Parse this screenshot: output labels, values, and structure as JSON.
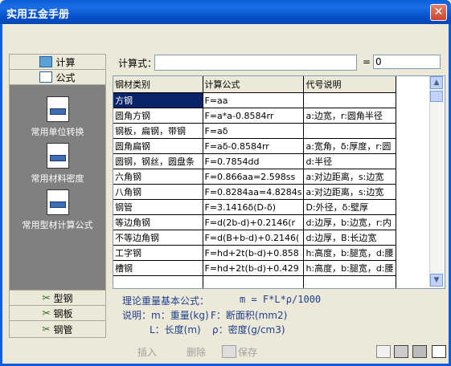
{
  "window": {
    "title": "实用五金手册",
    "close": "✕"
  },
  "left_panel": {
    "top_buttons": [
      {
        "label": "计算"
      },
      {
        "label": "公式"
      }
    ],
    "items": [
      {
        "label": "常用单位转换"
      },
      {
        "label": "常用材料密度"
      },
      {
        "label": "常用型材计算公式"
      }
    ],
    "bottom_buttons": [
      {
        "label": "型钢"
      },
      {
        "label": "钢板"
      },
      {
        "label": "钢管"
      }
    ]
  },
  "calc": {
    "label": "计算式：",
    "value": "",
    "eq": "=",
    "result": "0"
  },
  "table": {
    "headers": [
      "钢材类别",
      "计算公式",
      "代号说明"
    ],
    "rows": [
      [
        "方钢",
        "F=aa",
        ""
      ],
      [
        "圆角方钢",
        "F=a*a-0.8584rr",
        "a:边宽，r:圆角半径"
      ],
      [
        "钢板，扁钢，带钢",
        "F=aδ",
        ""
      ],
      [
        "圆角扁钢",
        "F=aδ-0.8584rr",
        "a:宽角，δ:厚度，r:圆"
      ],
      [
        "圆钢，钢丝，圆盘条",
        "F=0.7854dd",
        "d:半径"
      ],
      [
        "六角钢",
        "F=0.866aa=2.598ss",
        "a:对边距离，s:边宽"
      ],
      [
        "八角钢",
        "F=0.8284aa=4.8284s",
        "a:对边距离，s:边宽"
      ],
      [
        "钢管",
        "F=3.1416δ(D-δ)",
        "D:外径，δ:壁厚"
      ],
      [
        "等边角钢",
        "F=d(2b-d)+0.2146(r",
        "d:边厚，b:边宽，r:内"
      ],
      [
        "不等边角钢",
        "F=d(B+b-d)+0.2146(",
        "d:边厚，B:长边宽"
      ],
      [
        "工字钢",
        "F=hd+2t(b-d)+0.858",
        "h:高度，b:腿宽，d:腰"
      ],
      [
        "槽钢",
        "F=hd+2t(b-d)+0.429",
        "h:高度，b:腿宽，d:腰"
      ],
      [
        "",
        "",
        ""
      ]
    ]
  },
  "info": {
    "line1_label": "理论重量基本公式：",
    "line1_formula": "m = F*L*ρ/1000",
    "line2_label": "说明：m：重量(kg)",
    "line2_rest": "F：断面积(mm2)",
    "line3_a": "L：长度(m)",
    "line3_b": "ρ：密度(g/cm3)"
  },
  "toolbar": {
    "insert": "插入",
    "delete": "删除",
    "save": "保存"
  }
}
